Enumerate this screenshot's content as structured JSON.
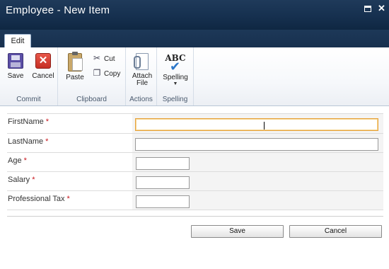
{
  "window": {
    "title": "Employee - New Item"
  },
  "ribbon": {
    "tabs": [
      {
        "label": "Edit",
        "active": true
      }
    ],
    "groups": {
      "commit": {
        "label": "Commit",
        "save_label": "Save",
        "cancel_label": "Cancel"
      },
      "clipboard": {
        "label": "Clipboard",
        "paste_label": "Paste",
        "cut_label": "Cut",
        "copy_label": "Copy"
      },
      "actions": {
        "label": "Actions",
        "attach_label_line1": "Attach",
        "attach_label_line2": "File"
      },
      "spelling": {
        "label": "Spelling",
        "spelling_label": "Spelling",
        "icon_text": "ABC"
      }
    }
  },
  "form": {
    "required_marker": "*",
    "fields": [
      {
        "label": "FirstName",
        "value": "",
        "required": true,
        "focused": true
      },
      {
        "label": "LastName",
        "value": "",
        "required": true
      },
      {
        "label": "Age",
        "value": "",
        "required": true
      },
      {
        "label": "Salary",
        "value": "",
        "required": true
      },
      {
        "label": "Professional Tax",
        "value": "",
        "required": true
      }
    ],
    "save_button": "Save",
    "cancel_button": "Cancel"
  },
  "colors": {
    "titlebar": "#1f3a5a",
    "required": "#c8161d",
    "focus_border": "#e6a23d",
    "field_bg": "#f4f4f4"
  },
  "icons": [
    "maximize-icon",
    "close-icon",
    "save-icon",
    "cancel-icon",
    "paste-icon",
    "cut-icon",
    "copy-icon",
    "attach-file-icon",
    "spelling-icon",
    "dropdown-arrow-icon"
  ]
}
